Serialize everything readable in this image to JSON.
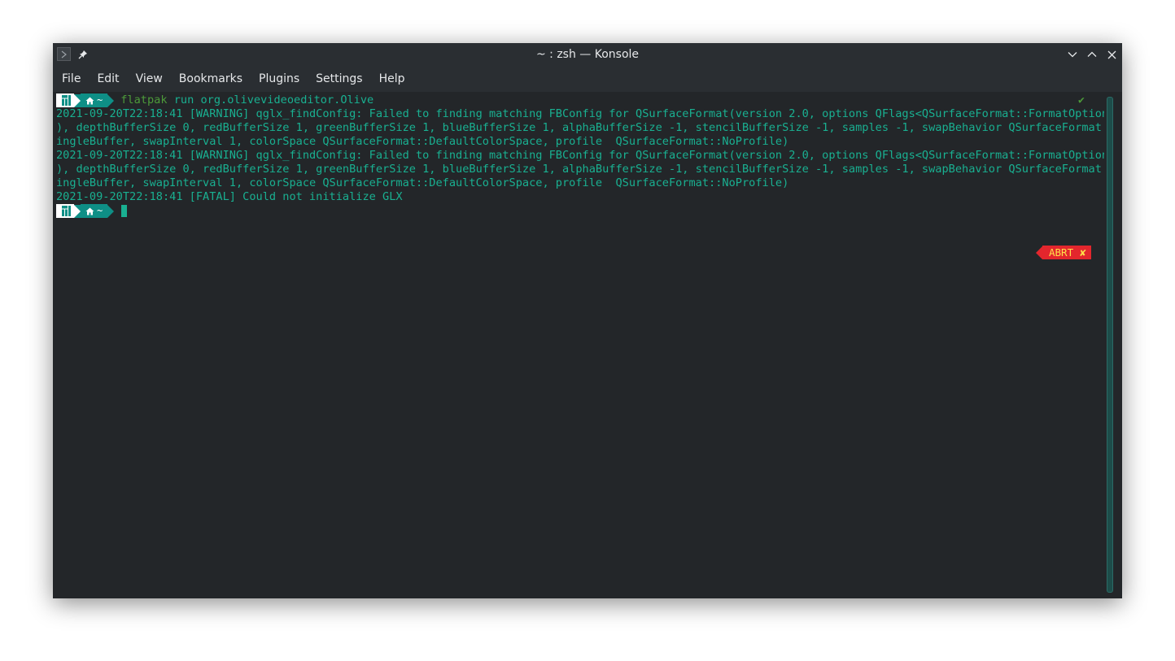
{
  "window": {
    "title": "~ : zsh — Konsole"
  },
  "menu": [
    {
      "label": "File"
    },
    {
      "label": "Edit"
    },
    {
      "label": "View"
    },
    {
      "label": "Bookmarks"
    },
    {
      "label": "Plugins"
    },
    {
      "label": "Settings"
    },
    {
      "label": "Help"
    }
  ],
  "prompt": {
    "home_label": "~",
    "status_ok": "✔",
    "abrt_label": "ABRT",
    "abrt_mark": "✘"
  },
  "command": {
    "name": "flatpak",
    "args": " run org.olivevideoeditor.Olive"
  },
  "output": [
    "2021-09-20T22:18:41 [WARNING] qglx_findConfig: Failed to finding matching FBConfig for QSurfaceFormat(version 2.0, options QFlags<QSurfaceFormat::FormatOption>(",
    "), depthBufferSize 0, redBufferSize 1, greenBufferSize 1, blueBufferSize 1, alphaBufferSize -1, stencilBufferSize -1, samples -1, swapBehavior QSurfaceFormat::S",
    "ingleBuffer, swapInterval 1, colorSpace QSurfaceFormat::DefaultColorSpace, profile  QSurfaceFormat::NoProfile)",
    "2021-09-20T22:18:41 [WARNING] qglx_findConfig: Failed to finding matching FBConfig for QSurfaceFormat(version 2.0, options QFlags<QSurfaceFormat::FormatOption>(",
    "), depthBufferSize 0, redBufferSize 1, greenBufferSize 1, blueBufferSize 1, alphaBufferSize -1, stencilBufferSize -1, samples -1, swapBehavior QSurfaceFormat::S",
    "ingleBuffer, swapInterval 1, colorSpace QSurfaceFormat::DefaultColorSpace, profile  QSurfaceFormat::NoProfile)",
    "2021-09-20T22:18:41 [FATAL] Could not initialize GLX"
  ],
  "colors": {
    "terminal_bg": "#232629",
    "text": "#19b091",
    "command_name": "#4c9a3a",
    "prompt_segment": "#0e8f86",
    "abrt_bg": "#e3262d",
    "abrt_text": "#ffe04a"
  },
  "icons": {
    "app": "konsole-icon",
    "pin": "pin-icon",
    "distro": "manjaro-icon",
    "home": "home-icon"
  }
}
